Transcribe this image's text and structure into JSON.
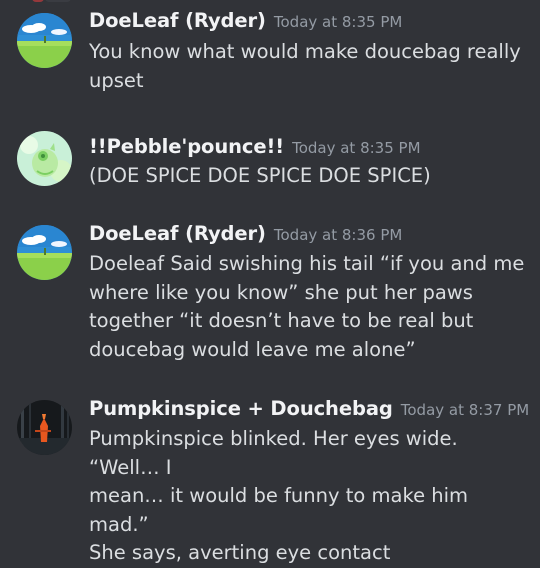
{
  "messages": [
    {
      "author": "DoeLeaf (Ryder)",
      "timestamp": "Today at 8:35 PM",
      "avatar_icon": "meadow-avatar-icon",
      "lines": [
        "You know what would make doucebag really",
        "upset"
      ]
    },
    {
      "author": "!!Pebble'pounce!!",
      "timestamp": "Today at 8:35 PM",
      "avatar_icon": "pastel-cat-avatar-icon",
      "lines": [
        "(DOE SPICE DOE SPICE DOE SPICE)"
      ]
    },
    {
      "author": "DoeLeaf (Ryder)",
      "timestamp": "Today at 8:36 PM",
      "avatar_icon": "meadow-avatar-icon",
      "lines": [
        "Doeleaf Said swishing his tail “if you and me",
        "where like you know” she put her paws",
        "together “it doesn’t have to be real but",
        "doucebag would leave me alone”"
      ]
    },
    {
      "author": "Pumpkinspice + Douchebag",
      "timestamp": "Today at 8:37 PM",
      "avatar_icon": "dark-forest-avatar-icon",
      "lines": [
        "Pumpkinspice blinked. Her eyes wide. “Well… I",
        "mean… it would be funny to make him mad.”",
        "She says, averting eye contact"
      ]
    }
  ],
  "colors": {
    "background": "#313338",
    "username": "#f2f3f5",
    "timestamp": "#949ba4",
    "text": "#dbdee1"
  }
}
